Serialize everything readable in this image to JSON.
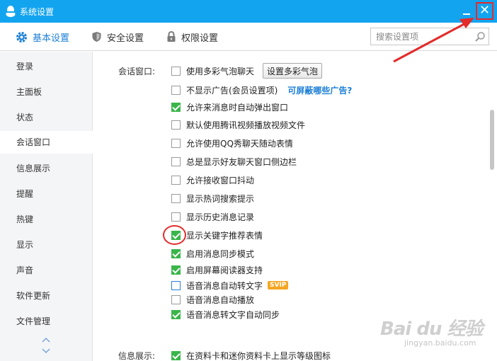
{
  "window": {
    "title": "系统设置",
    "close_glyph": "✕"
  },
  "toolbar": {
    "tabs": [
      {
        "label": "基本设置",
        "icon": "gear-icon",
        "active": true
      },
      {
        "label": "安全设置",
        "icon": "shield-icon",
        "active": false
      },
      {
        "label": "权限设置",
        "icon": "lock-icon",
        "active": false
      }
    ],
    "search": {
      "placeholder": "搜索设置项",
      "value": ""
    }
  },
  "sidebar": {
    "items": [
      {
        "label": "登录"
      },
      {
        "label": "主面板"
      },
      {
        "label": "状态"
      },
      {
        "label": "会话窗口",
        "active": true
      },
      {
        "label": "信息展示"
      },
      {
        "label": "提醒"
      },
      {
        "label": "热键"
      },
      {
        "label": "显示"
      },
      {
        "label": "声音"
      },
      {
        "label": "软件更新"
      },
      {
        "label": "文件管理"
      }
    ]
  },
  "content": {
    "session_label": "会话窗口:",
    "options": [
      {
        "label": "使用多彩气泡聊天",
        "checked": false,
        "button": "设置多彩气泡"
      },
      {
        "label": "不显示广告(会员设置项)",
        "checked": false,
        "link": "可屏蔽哪些广告?"
      },
      {
        "label": "允许来消息时自动弹出窗口",
        "checked": true
      },
      {
        "label": "默认使用腾讯视频播放视频文件",
        "checked": false
      },
      {
        "label": "允许使用QQ秀聊天随动表情",
        "checked": false
      },
      {
        "label": "总是显示好友聊天窗口侧边栏",
        "checked": false
      },
      {
        "label": "允许接收窗口抖动",
        "checked": false
      },
      {
        "label": "显示热词搜索提示",
        "checked": false
      },
      {
        "label": "显示历史消息记录",
        "checked": false
      },
      {
        "label": "显示关键字推荐表情",
        "checked": true
      },
      {
        "label": "启用消息同步模式",
        "checked": true
      },
      {
        "label": "启用屏幕阅读器支持",
        "checked": true
      },
      {
        "label": "语音消息自动转文字",
        "checked": false,
        "badge": "SVIP"
      },
      {
        "label": "语音消息自动播放",
        "checked": false
      },
      {
        "label": "语音消息转文字自动同步",
        "checked": true
      }
    ],
    "info_label": "信息展示:",
    "info_options": [
      {
        "label": "在资料卡和迷你资料卡上显示等级图标",
        "checked": true
      }
    ]
  },
  "watermark": {
    "main": "Bai du 经验",
    "sub": "jingyan.baidu.com"
  },
  "colors": {
    "titlebar": "#13a4f0",
    "accent": "#1c7fd6",
    "check": "#3ab54a",
    "annotation": "#e22b2b"
  }
}
